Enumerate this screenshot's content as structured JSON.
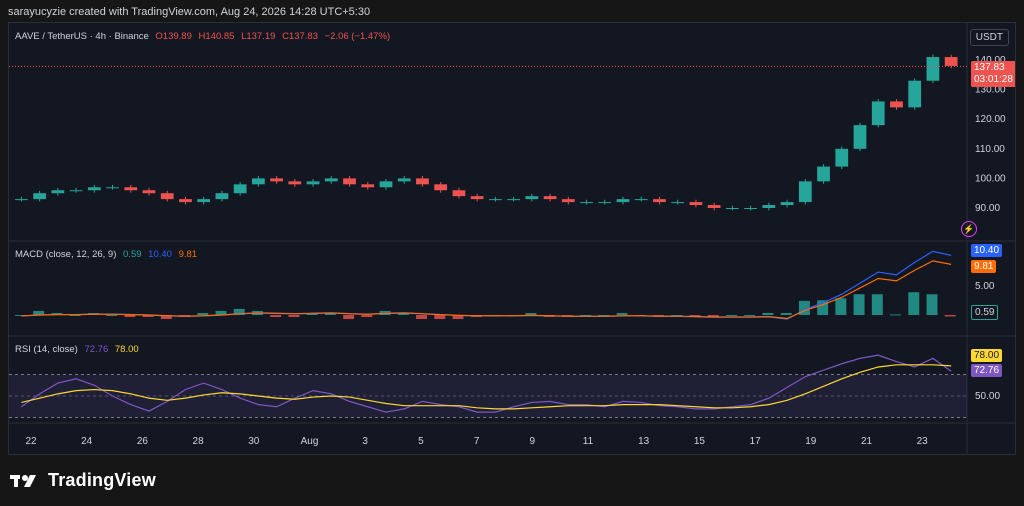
{
  "header": {
    "text": "sarayucyzie created with TradingView.com, Aug 24, 2026 14:28 UTC+5:30"
  },
  "currency_button": "USDT",
  "price_legend": {
    "symbol": "AAVE / TetherUS · 4h · Binance",
    "open": "O139.89",
    "high": "H140.85",
    "low": "L137.19",
    "close": "C137.83",
    "change": "−2.06 (−1.47%)"
  },
  "price_tag": {
    "price": "137.83",
    "countdown": "03:01:28"
  },
  "macd_legend": {
    "title": "MACD (close, 12, 26, 9)",
    "hist": "0.59",
    "macd": "10.40",
    "signal": "9.81"
  },
  "rsi_legend": {
    "title": "RSI (14, close)",
    "rsi": "72.76",
    "ma": "78.00"
  },
  "footer": {
    "brand": "TradingView"
  },
  "colors": {
    "up": "#26a69a",
    "down": "#ef5350",
    "macd": "#2962ff",
    "signal": "#ff6d00",
    "rsi": "#7e57c2",
    "rsi_ma": "#fdd835",
    "bg": "#131722"
  },
  "chart_data": {
    "type": "candlestick",
    "price_axis_ticks": [
      "90.00",
      "100.00",
      "110.00",
      "120.00",
      "130.00",
      "140.00"
    ],
    "macd_axis_ticks": [
      "5.00"
    ],
    "rsi_axis_ticks": [
      "50.00"
    ],
    "x_tick_labels": [
      "22",
      "24",
      "26",
      "28",
      "30",
      "Aug",
      "3",
      "5",
      "7",
      "9",
      "11",
      "13",
      "15",
      "17",
      "19",
      "21",
      "23"
    ],
    "price_close_approx": [
      93,
      95,
      96,
      96,
      97,
      97,
      96,
      95,
      93,
      92,
      93,
      95,
      98,
      100,
      99,
      98,
      99,
      100,
      98,
      97,
      99,
      100,
      98,
      96,
      94,
      93,
      93,
      93,
      94,
      93,
      92,
      92,
      92,
      93,
      93,
      92,
      92,
      91,
      90,
      90,
      90,
      91,
      92,
      99,
      104,
      110,
      118,
      126,
      124,
      133,
      141,
      138
    ],
    "rsi_approx": [
      40,
      52,
      62,
      66,
      60,
      50,
      42,
      36,
      45,
      56,
      62,
      56,
      48,
      42,
      40,
      48,
      55,
      52,
      45,
      40,
      35,
      38,
      45,
      42,
      40,
      35,
      35,
      40,
      44,
      45,
      42,
      42,
      40,
      45,
      44,
      41,
      40,
      38,
      38,
      40,
      42,
      48,
      58,
      68,
      74,
      80,
      85,
      88,
      82,
      77,
      85,
      73
    ],
    "rsi_ma_approx": [
      44,
      48,
      52,
      55,
      56,
      55,
      52,
      48,
      46,
      48,
      51,
      53,
      52,
      50,
      48,
      47,
      49,
      50,
      49,
      46,
      43,
      41,
      41,
      41,
      41,
      39,
      38,
      38,
      39,
      40,
      41,
      41,
      41,
      42,
      42,
      42,
      41,
      40,
      39,
      39,
      40,
      42,
      46,
      52,
      59,
      66,
      72,
      77,
      79,
      79,
      79,
      78
    ],
    "last_rsi": 72.76,
    "last_rsi_ma": 78.0,
    "last_macd": 10.4,
    "last_signal": 9.81,
    "last_hist": 0.59
  }
}
